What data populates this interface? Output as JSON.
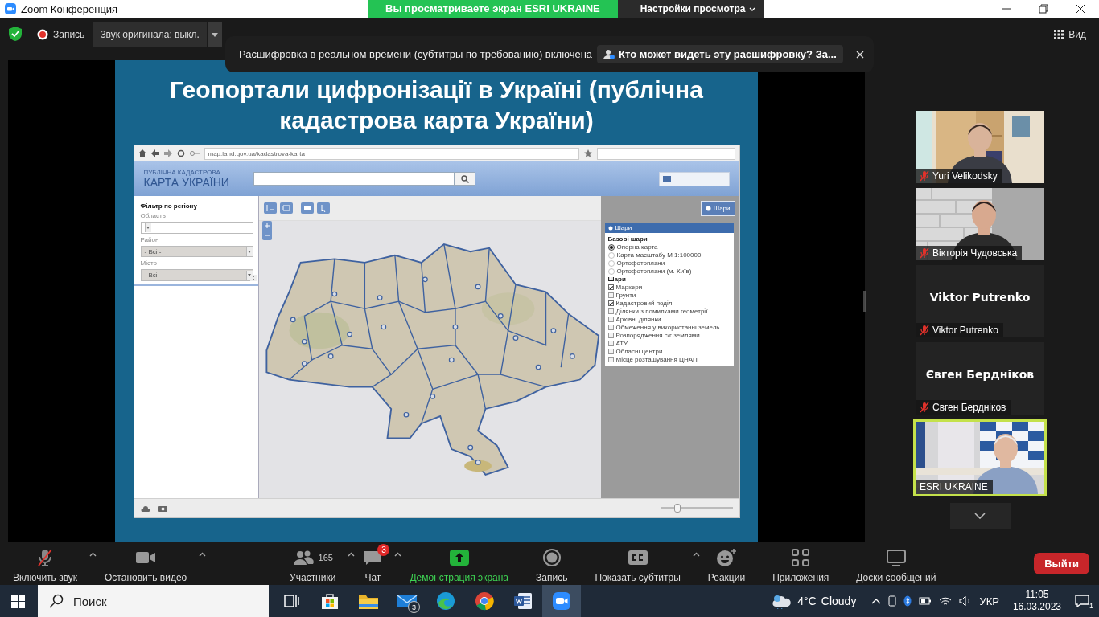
{
  "window": {
    "title": "Zoom Конференция",
    "share_banner": "Вы просматриваете экран ESRI UKRAINE",
    "view_settings": "Настройки просмотра"
  },
  "meeting_bar": {
    "record": "Запись",
    "audio": "Звук оригинала: выкл.",
    "view": "Вид"
  },
  "caption_notice": {
    "text": "Расшифровка в реальном времени (субтитры по требованию) включена",
    "link": "Кто может видеть эту расшифровку? За..."
  },
  "slide": {
    "title": "Геопортали цифронізації в Україні (публічна кадастрова карта України)",
    "portal": {
      "address": "map.land.gov.ua/kadastrova-karta",
      "logo_top": "ПУБЛІЧНА КАДАСТРОВА",
      "logo_bottom": "КАРТА УКРАЇНИ",
      "filter": {
        "title": "Фільтр по регіону",
        "fields": [
          {
            "label": "Область",
            "disabled": false
          },
          {
            "label": "Район",
            "value": "- Всі -",
            "disabled": true
          },
          {
            "label": "Місто",
            "value": "- Всі -",
            "disabled": true
          }
        ]
      },
      "layers_button": "Шари",
      "layers": {
        "title": "Шари",
        "base_title": "Базові шари",
        "base": [
          {
            "label": "Опорна карта",
            "selected": true
          },
          {
            "label": "Карта масштабу М 1:100000",
            "selected": false
          },
          {
            "label": "Ортофотоплани",
            "selected": false
          },
          {
            "label": "Ортофотоплани (м. Київ)",
            "selected": false
          }
        ],
        "overlay_title": "Шари",
        "overlay": [
          {
            "label": "Маркери",
            "checked": true
          },
          {
            "label": "Грунти",
            "checked": false
          },
          {
            "label": "Кадастровий поділ",
            "checked": true
          },
          {
            "label": "Ділянки з помилками геометрії",
            "checked": false
          },
          {
            "label": "Архівні ділянки",
            "checked": false
          },
          {
            "label": "Обмеження у використанні земель",
            "checked": false
          },
          {
            "label": "Розпорядження с/г землями",
            "checked": false
          },
          {
            "label": "АТУ",
            "checked": false
          },
          {
            "label": "Обласні центри",
            "checked": false
          },
          {
            "label": "Місце розташування ЦНАП",
            "checked": false
          }
        ]
      },
      "zoom_slider": {
        "level": 0.24
      }
    }
  },
  "participants": [
    {
      "name": "Yuri Velikodsky",
      "kind": "video",
      "muted": true,
      "speaking": false
    },
    {
      "name": "Вікторія Чудовська",
      "kind": "video",
      "muted": true,
      "speaking": false
    },
    {
      "name": "Viktor Putrenko",
      "display_name": "Viktor Putrenko",
      "kind": "name",
      "muted": true,
      "speaking": false
    },
    {
      "name": "Євген Бердніков",
      "display_name": "Євген Бердніков",
      "kind": "name",
      "muted": true,
      "speaking": false
    },
    {
      "name": "ESRI UKRAINE",
      "kind": "video",
      "muted": false,
      "speaking": true
    }
  ],
  "toolbar": {
    "items": [
      {
        "label": "Включить звук",
        "kind": "mic_off",
        "caret": true
      },
      {
        "label": "Остановить видео",
        "kind": "video",
        "caret": true
      },
      {
        "label": "Участники",
        "kind": "participants",
        "count": "165",
        "caret": true
      },
      {
        "label": "Чат",
        "kind": "chat",
        "badge": "3",
        "caret": true
      },
      {
        "label": "Демонстрация экрана",
        "kind": "share",
        "caret": false
      },
      {
        "label": "Запись",
        "kind": "record",
        "caret": false
      },
      {
        "label": "Показать субтитры",
        "kind": "cc",
        "caret": true
      },
      {
        "label": "Реакции",
        "kind": "reactions",
        "caret": false
      },
      {
        "label": "Приложения",
        "kind": "apps",
        "caret": false
      },
      {
        "label": "Доски сообщений",
        "kind": "whiteboards",
        "caret": false
      }
    ],
    "leave": "Выйти"
  },
  "taskbar": {
    "search_placeholder": "Поиск",
    "apps": [
      {
        "kind": "taskview",
        "active": false
      },
      {
        "kind": "store",
        "active": false
      },
      {
        "kind": "explorer",
        "active": false
      },
      {
        "kind": "mail",
        "active": false,
        "badge": "3"
      },
      {
        "kind": "edge",
        "active": false
      },
      {
        "kind": "chrome",
        "active": false
      },
      {
        "kind": "word",
        "active": false
      },
      {
        "kind": "zoom",
        "active": true
      }
    ],
    "temperature": "4°C",
    "weather": "Cloudy",
    "language": "УКР",
    "time": "11:05",
    "date": "16.03.2023",
    "notifications": "1"
  }
}
